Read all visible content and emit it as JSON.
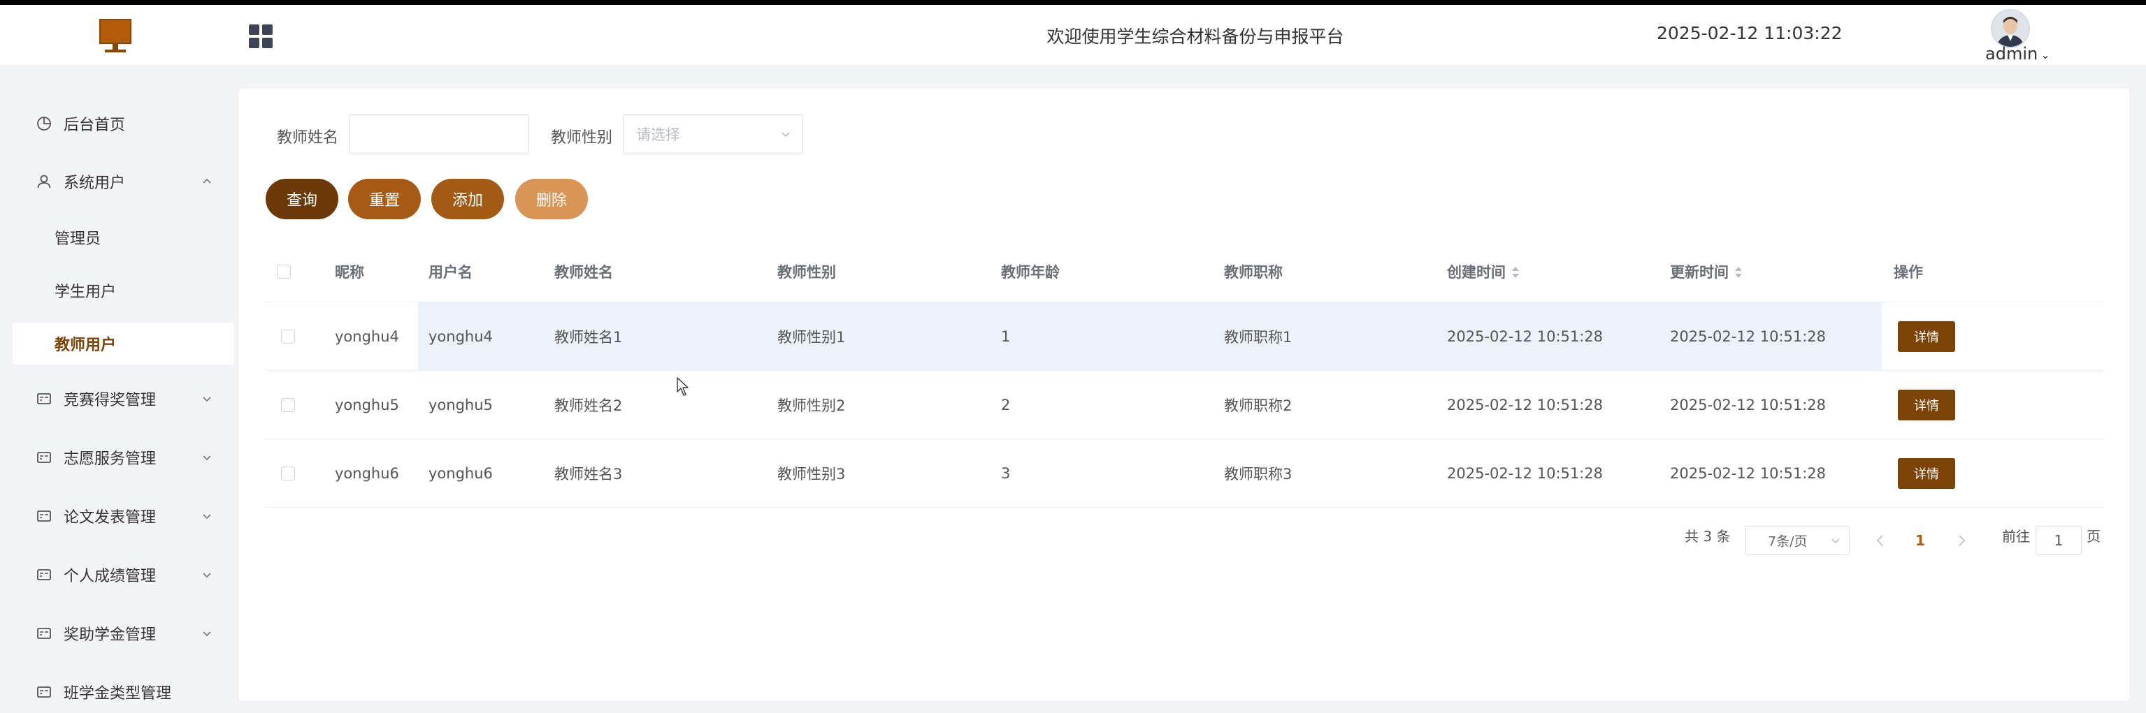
{
  "header": {
    "title": "欢迎使用学生综合材料备份与申报平台",
    "datetime": "2025-02-12 11:03:22",
    "username": "admin"
  },
  "sidebar": {
    "items": [
      {
        "label": "后台首页",
        "icon": "pie-chart-icon"
      },
      {
        "label": "系统用户",
        "icon": "user-icon",
        "expanded": true
      },
      {
        "label": "管理员"
      },
      {
        "label": "学生用户"
      },
      {
        "label": "教师用户",
        "active": true
      },
      {
        "label": "竞赛得奖管理",
        "icon": "card-icon"
      },
      {
        "label": "志愿服务管理",
        "icon": "card-icon"
      },
      {
        "label": "论文发表管理",
        "icon": "card-icon"
      },
      {
        "label": "个人成绩管理",
        "icon": "card-icon"
      },
      {
        "label": "奖助学金管理",
        "icon": "card-icon"
      },
      {
        "label": "班学金类型管理",
        "icon": "card-icon"
      }
    ]
  },
  "search": {
    "name_label": "教师姓名",
    "name_value": "",
    "gender_label": "教师性别",
    "gender_placeholder": "请选择"
  },
  "buttons": {
    "query": "查询",
    "reset": "重置",
    "add": "添加",
    "delete": "删除"
  },
  "table": {
    "headers": [
      "昵称",
      "用户名",
      "教师姓名",
      "教师性别",
      "教师年龄",
      "教师职称",
      "创建时间",
      "更新时间",
      "操作"
    ],
    "rows": [
      {
        "nickname": "yonghu4",
        "username": "yonghu4",
        "name": "教师姓名1",
        "gender": "教师性别1",
        "age": "1",
        "title": "教师职称1",
        "created": "2025-02-12 10:51:28",
        "updated": "2025-02-12 10:51:28",
        "action": "详情"
      },
      {
        "nickname": "yonghu5",
        "username": "yonghu5",
        "name": "教师姓名2",
        "gender": "教师性别2",
        "age": "2",
        "title": "教师职称2",
        "created": "2025-02-12 10:51:28",
        "updated": "2025-02-12 10:51:28",
        "action": "详情"
      },
      {
        "nickname": "yonghu6",
        "username": "yonghu6",
        "name": "教师姓名3",
        "gender": "教师性别3",
        "age": "3",
        "title": "教师职称3",
        "created": "2025-02-12 10:51:28",
        "updated": "2025-02-12 10:51:28",
        "action": "详情"
      }
    ]
  },
  "pagination": {
    "total": "共 3 条",
    "page_size": "7条/页",
    "current": "1",
    "goto_label": "前往",
    "goto_value": "1",
    "page_unit": "页"
  },
  "colors": {
    "accent": "#7b4306",
    "button_query": "#6b3a08",
    "button_reset": "#a65a14",
    "button_add": "#a25a14",
    "button_delete": "#d99556",
    "row_hover": "#ecf2fb"
  }
}
